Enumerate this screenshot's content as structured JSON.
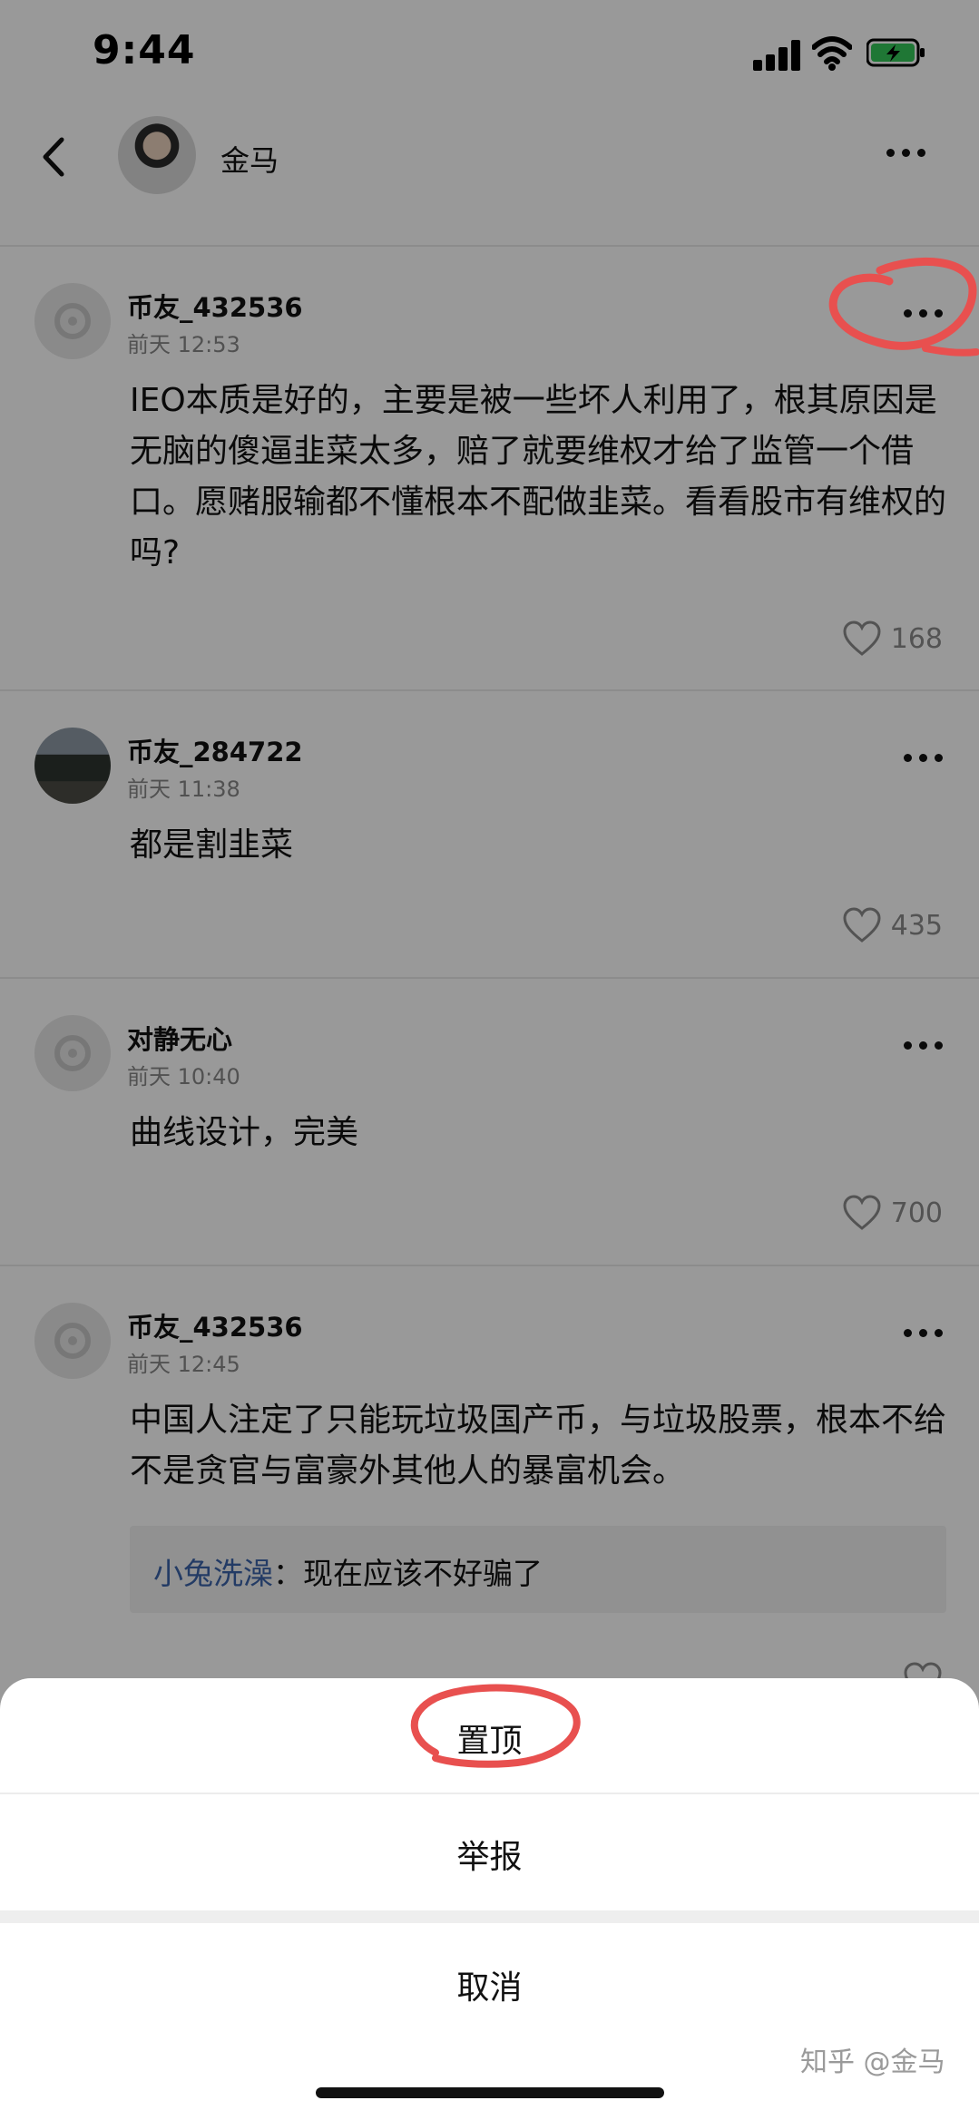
{
  "status_bar": {
    "time": "9:44"
  },
  "header": {
    "name": "金马"
  },
  "comments": [
    {
      "user": "币友_432536",
      "time": "前天 12:53",
      "text": "IEO本质是好的，主要是被一些坏人利用了，根其原因是无脑的傻逼韭菜太多，赔了就要维权才给了监管一个借口。愿赌服输都不懂根本不配做韭菜。看看股市有维权的吗?",
      "likes": "168"
    },
    {
      "user": "币友_284722",
      "time": "前天 11:38",
      "text": "都是割韭菜",
      "likes": "435"
    },
    {
      "user": "对静无心",
      "time": "前天 10:40",
      "text": "曲线设计，完美",
      "likes": "700"
    },
    {
      "user": "币友_432536",
      "time": "前天 12:45",
      "text": "中国人注定了只能玩垃圾国产币，与垃圾股票，根本不给不是贪官与富豪外其他人的暴富机会。",
      "reply_user": "小兔洗澡",
      "reply_sep": "：",
      "reply_text": "现在应该不好骗了"
    }
  ],
  "action_sheet": {
    "pin": "置顶",
    "report": "举报",
    "cancel": "取消"
  },
  "watermark": "知乎 @金马",
  "colors": {
    "annotation": "#e8504f",
    "reply_name": "#3b63a8"
  }
}
